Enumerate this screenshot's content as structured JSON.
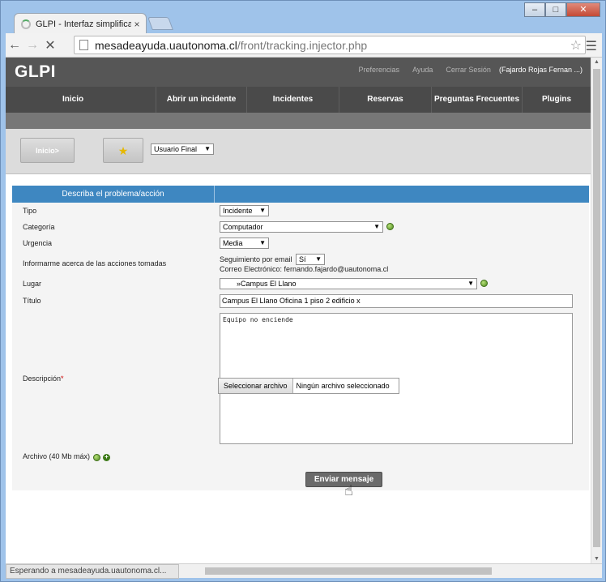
{
  "browser": {
    "tab_title": "GLPI - Interfaz simplificad",
    "tab_close": "×",
    "url_host": "mesadeayuda.uautonoma.cl",
    "url_path": "/front/tracking.injector.php",
    "status_text": "Esperando a mesadeayuda.uautonoma.cl...",
    "window_buttons": {
      "minimize": "–",
      "maximize": "□",
      "close": "✕"
    }
  },
  "header": {
    "logo": "GLPI",
    "links": [
      "Preferencias",
      "Ayuda",
      "Cerrar Sesión"
    ],
    "user": "(Fajardo Rojas Fernan ...)"
  },
  "menu": {
    "items": [
      "Inicio",
      "Abrir un incidente",
      "Incidentes",
      "Reservas",
      "Preguntas Frecuentes",
      "Plugins"
    ]
  },
  "actions": {
    "inicio_label": "Inicio>",
    "profile_select": "Usuario Final"
  },
  "form": {
    "section_title": "Describa el problema/acción",
    "tipo": {
      "label": "Tipo",
      "value": "Incidente"
    },
    "categoria": {
      "label": "Categoría",
      "value": "Computador"
    },
    "urgencia": {
      "label": "Urgencia",
      "value": "Media"
    },
    "notify": {
      "label": "Informarme acerca de las acciones tomadas",
      "email_follow_label": "Seguimiento por email",
      "email_follow_value": "Sí",
      "email_line": "Correo Electrónico: fernando.fajardo@uautonoma.cl"
    },
    "lugar": {
      "label": "Lugar",
      "value": "»Campus El Llano"
    },
    "titulo": {
      "label": "Título",
      "value": "Campus El Llano Oficina 1 piso 2 edificio x"
    },
    "descripcion": {
      "label": "Descripción",
      "required_mark": "*",
      "value": "Equipo no enciende"
    },
    "archivo": {
      "label": "Archivo (40 Mb máx)",
      "button": "Seleccionar archivo",
      "status": "Ningún archivo seleccionado"
    },
    "submit": "Enviar mensaje"
  }
}
